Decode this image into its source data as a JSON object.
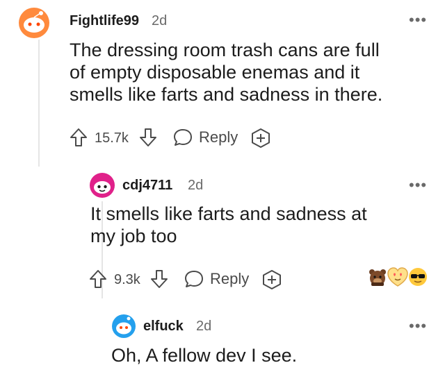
{
  "comments": [
    {
      "username": "Fightlife99",
      "age": "2d",
      "more": "•••",
      "lines": [
        "The dressing room trash cans are full",
        "of empty disposable enemas and it",
        "smells like farts and sadness in there."
      ],
      "votes": "15.7k",
      "reply_label": "Reply",
      "avatar_color": "#ff8a3d"
    },
    {
      "username": "cdj4711",
      "age": "2d",
      "more": "•••",
      "lines": [
        "It smells like farts and sadness at",
        "my job too"
      ],
      "votes": "9.3k",
      "reply_label": "Reply",
      "avatar_color": "#e0218a",
      "awards": [
        "bear-award-icon",
        "heart-eyes-award-icon",
        "sunglasses-award-icon"
      ]
    },
    {
      "username": "elfuck",
      "age": "2d",
      "more": "•••",
      "lines": [
        "Oh, A fellow dev I see."
      ],
      "avatar_color": "#24a0ed"
    }
  ]
}
